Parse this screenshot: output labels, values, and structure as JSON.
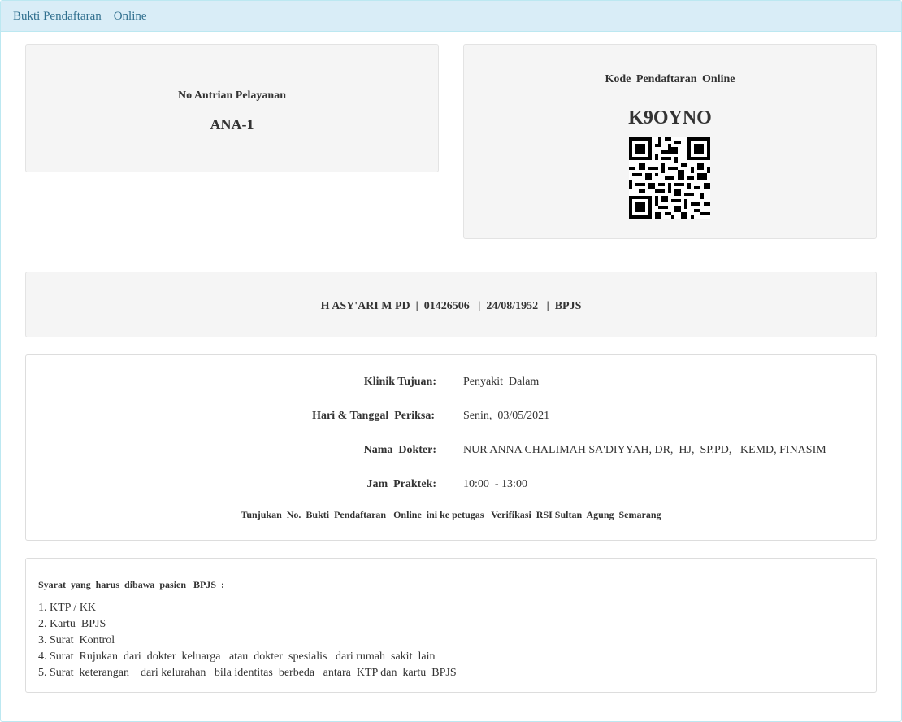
{
  "header": {
    "title": "Bukti Pendaftaran    Online"
  },
  "antrian": {
    "label": "No Antrian Pelayanan",
    "value": "ANA-1"
  },
  "kode": {
    "label": "Kode  Pendaftaran  Online",
    "value": "K9OYNO"
  },
  "patient": {
    "line": "H ASY'ARI M PD  |  01426506   |  24/08/1952   |  BPJS"
  },
  "details": {
    "rows": [
      {
        "label": "Klinik Tujuan:",
        "value": "Penyakit  Dalam"
      },
      {
        "label": "Hari & Tanggal  Periksa:",
        "value": "Senin,  03/05/2021"
      },
      {
        "label": "Nama  Dokter:",
        "value": "NUR ANNA CHALIMAH SA'DIYYAH, DR,  HJ,  SP.PD,   KEMD, FINASIM"
      },
      {
        "label": "Jam  Praktek:",
        "value": "10:00  - 13:00"
      }
    ],
    "notice": "Tunjukan  No.  Bukti  Pendaftaran   Online  ini ke petugas   Verifikasi  RSI Sultan  Agung  Semarang"
  },
  "requirements": {
    "title": "Syarat  yang  harus  dibawa  pasien   BPJS  :",
    "items": [
      "1. KTP / KK",
      "2. Kartu  BPJS",
      "3. Surat  Kontrol",
      "4. Surat  Rujukan  dari  dokter  keluarga   atau  dokter  spesialis   dari rumah  sakit  lain",
      "5. Surat  keterangan    dari kelurahan   bila identitas  berbeda   antara  KTP dan  kartu  BPJS"
    ]
  },
  "qr_icon": "qr-code-icon"
}
